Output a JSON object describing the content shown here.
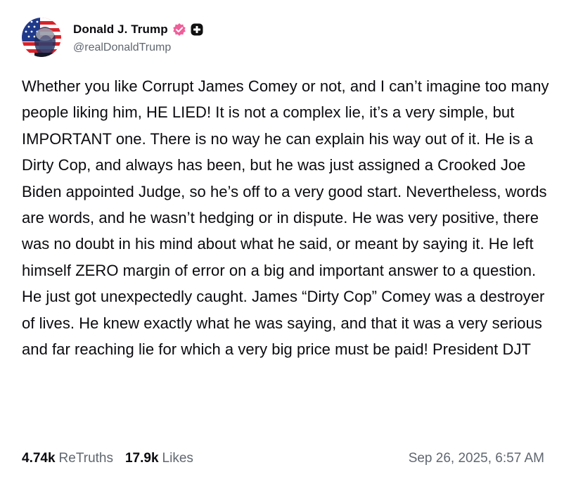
{
  "author": {
    "display_name": "Donald J. Trump",
    "handle": "@realDonaldTrump",
    "avatar_icon": "flag-portrait-avatar",
    "verified_icon": "verified-badge-icon",
    "plus_icon": "plus-badge-icon",
    "verified_color": "#ef5f9a",
    "plus_badge_color": "#111111"
  },
  "post": {
    "text": "Whether you like Corrupt James Comey or not, and I can’t imagine too many people liking him, HE LIED! It is not a complex lie, it’s a very simple, but IMPORTANT one. There is no way he can explain his way out of it. He is a Dirty Cop, and always has been, but he was just assigned a Crooked Joe Biden appointed Judge, so he’s off to a very good start. Nevertheless, words are words, and he wasn’t hedging or in dispute. He was very positive, there was no doubt in his mind about what he said, or meant by saying it. He left himself ZERO margin of error on a big and important answer to a question. He just got unexpectedly caught. James “Dirty Cop” Comey was a destroyer of lives. He knew exactly what he was saying, and that it was a very serious and far reaching lie for which a very big price must be paid! President DJT"
  },
  "stats": {
    "retruths_count": "4.74k",
    "retruths_label": "ReTruths",
    "likes_count": "17.9k",
    "likes_label": "Likes"
  },
  "timestamp": "Sep 26, 2025, 6:57 AM",
  "colors": {
    "text_primary": "#0b0b0f",
    "text_secondary": "#606770",
    "background": "#ffffff"
  }
}
